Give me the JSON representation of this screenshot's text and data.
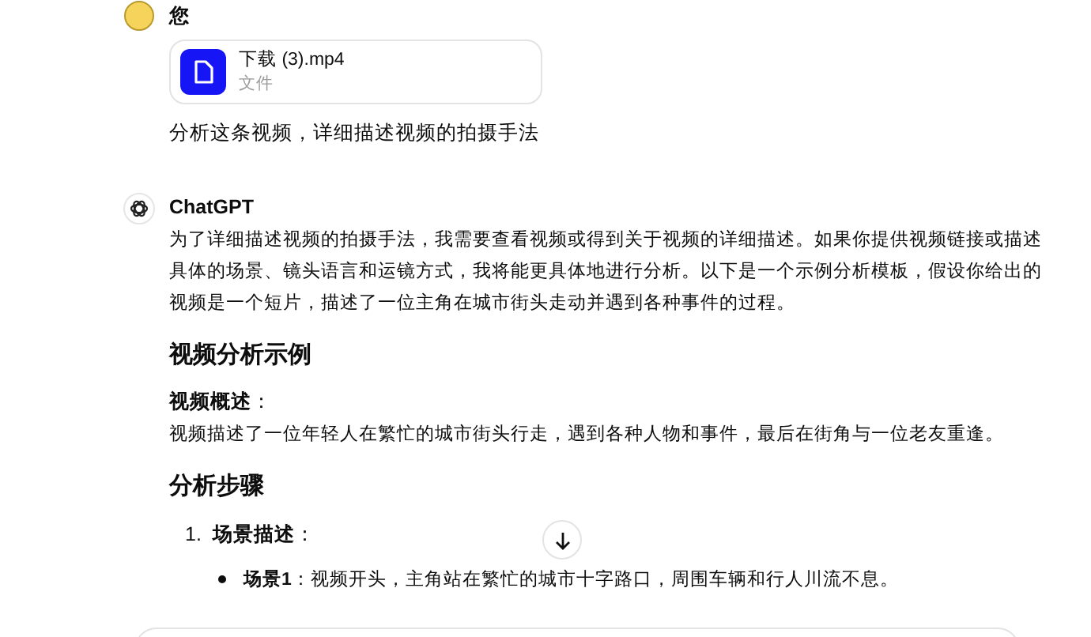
{
  "user": {
    "name": "您",
    "file": {
      "name": "下载 (3).mp4",
      "type": "文件"
    },
    "message": "分析这条视频，详细描述视频的拍摄手法"
  },
  "assistant": {
    "name": "ChatGPT",
    "intro": "为了详细描述视频的拍摄手法，我需要查看视频或得到关于视频的详细描述。如果你提供视频链接或描述具体的场景、镜头语言和运镜方式，我将能更具体地进行分析。以下是一个示例分析模板，假设你给出的视频是一个短片，描述了一位主角在城市街头走动并遇到各种事件的过程。",
    "blocks": [
      {
        "kind": "heading",
        "text": "视频分析示例"
      },
      {
        "kind": "label",
        "text": "**视频概述**："
      },
      {
        "kind": "paragraph",
        "text": "视频描述了一位年轻人在繁忙的城市街头行走，遇到各种人物和事件，最后在街角与一位老友重逢。"
      },
      {
        "kind": "heading",
        "text": "分析步骤"
      },
      {
        "kind": "numbered",
        "number": "1.",
        "text": "**场景描述**："
      },
      {
        "kind": "bullet",
        "text": "**场景1**：视频开头，主角站在繁忙的城市十字路口，周围车辆和行人川流不息。"
      }
    ]
  }
}
